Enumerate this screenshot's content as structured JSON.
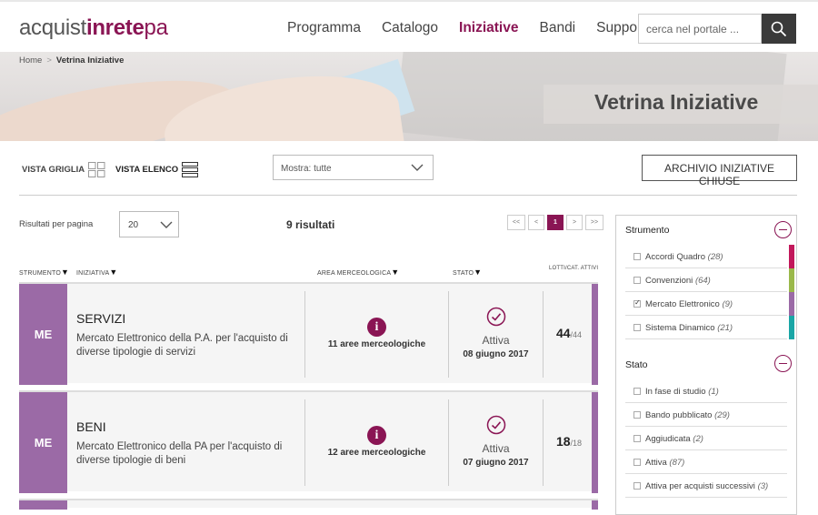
{
  "header": {
    "logo": {
      "a": "acquist",
      "b": "inrete",
      "c": "pa"
    },
    "nav": [
      "Programma",
      "Catalogo",
      "Iniziative",
      "Bandi",
      "Supporto"
    ],
    "nav_active": "Iniziative",
    "search_placeholder": "cerca nel portale ..."
  },
  "breadcrumb": {
    "home": "Home",
    "sep": ">",
    "current": "Vetrina Iniziative"
  },
  "banner_title": "Vetrina Iniziative",
  "view": {
    "grid_label": "VISTA GRIGLIA",
    "list_label": "VISTA ELENCO",
    "filter_value": "Mostra: tutte",
    "archive_button": "ARCHIVIO INIZIATIVE CHIUSE"
  },
  "results": {
    "per_page_label": "Risultati per pagina",
    "per_page_value": "20",
    "count": "9 risultati",
    "pager": [
      "<<",
      "<",
      "1",
      ">",
      ">>"
    ]
  },
  "columns": {
    "strumento": "STRUMENTO",
    "iniziativa": "INIZIATIVA",
    "area": "AREA MERCEOLOGICA",
    "stato": "STATO",
    "lotti": "LOTTI/CAT. ATTIVI"
  },
  "rows": [
    {
      "tag": "ME",
      "title": "SERVIZI",
      "desc": "Mercato Elettronico della P.A. per l'acquisto di diverse tipologie di servizi",
      "aree": "11 aree merceologiche",
      "stato": "Attiva",
      "data": "08 giugno 2017",
      "lotti_active": "44",
      "lotti_total": "/44"
    },
    {
      "tag": "ME",
      "title": "BENI",
      "desc": "Mercato Elettronico della PA per l'acquisto di diverse tipologie di beni",
      "aree": "12 aree merceologiche",
      "stato": "Attiva",
      "data": "07 giugno 2017",
      "lotti_active": "18",
      "lotti_total": "/18"
    }
  ],
  "sidebar": {
    "strumento_title": "Strumento",
    "strumento": [
      {
        "label": "Accordi Quadro",
        "count": "(28)",
        "checked": false,
        "color": "#c2185b"
      },
      {
        "label": "Convenzioni",
        "count": "(64)",
        "checked": false,
        "color": "#9ab84a"
      },
      {
        "label": "Mercato Elettronico",
        "count": "(9)",
        "checked": true,
        "color": "#9b6aa6"
      },
      {
        "label": "Sistema Dinamico",
        "count": "(21)",
        "checked": false,
        "color": "#1aa6a6"
      }
    ],
    "stato_title": "Stato",
    "stato": [
      {
        "label": "In fase di studio",
        "count": "(1)"
      },
      {
        "label": "Bando pubblicato",
        "count": "(29)"
      },
      {
        "label": "Aggiudicata",
        "count": "(2)"
      },
      {
        "label": "Attiva",
        "count": "(87)"
      },
      {
        "label": "Attiva per acquisti successivi",
        "count": "(3)"
      }
    ]
  },
  "colors": {
    "brand": "#8a1554",
    "me_tag": "#9b6aa6"
  }
}
